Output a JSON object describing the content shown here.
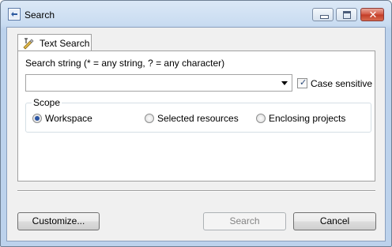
{
  "window": {
    "title": "Search",
    "close_glyph": "✕"
  },
  "tab": {
    "label": "Text Search",
    "icon": "text-search-icon"
  },
  "search": {
    "label": "Search string (* = any string, ? = any character)",
    "value": "",
    "case_sensitive_label": "Case sensitive",
    "case_sensitive_checked": true,
    "check_glyph": "✓"
  },
  "scope": {
    "title": "Scope",
    "options": [
      {
        "label": "Workspace",
        "selected": true
      },
      {
        "label": "Selected resources",
        "selected": false
      },
      {
        "label": "Enclosing projects",
        "selected": false
      }
    ]
  },
  "buttons": {
    "customize": "Customize...",
    "search": "Search",
    "cancel": "Cancel"
  },
  "colors": {
    "title_gradient_top": "#dbe8f6",
    "close_red": "#c23b26",
    "radio_dot": "#2b55a3"
  }
}
